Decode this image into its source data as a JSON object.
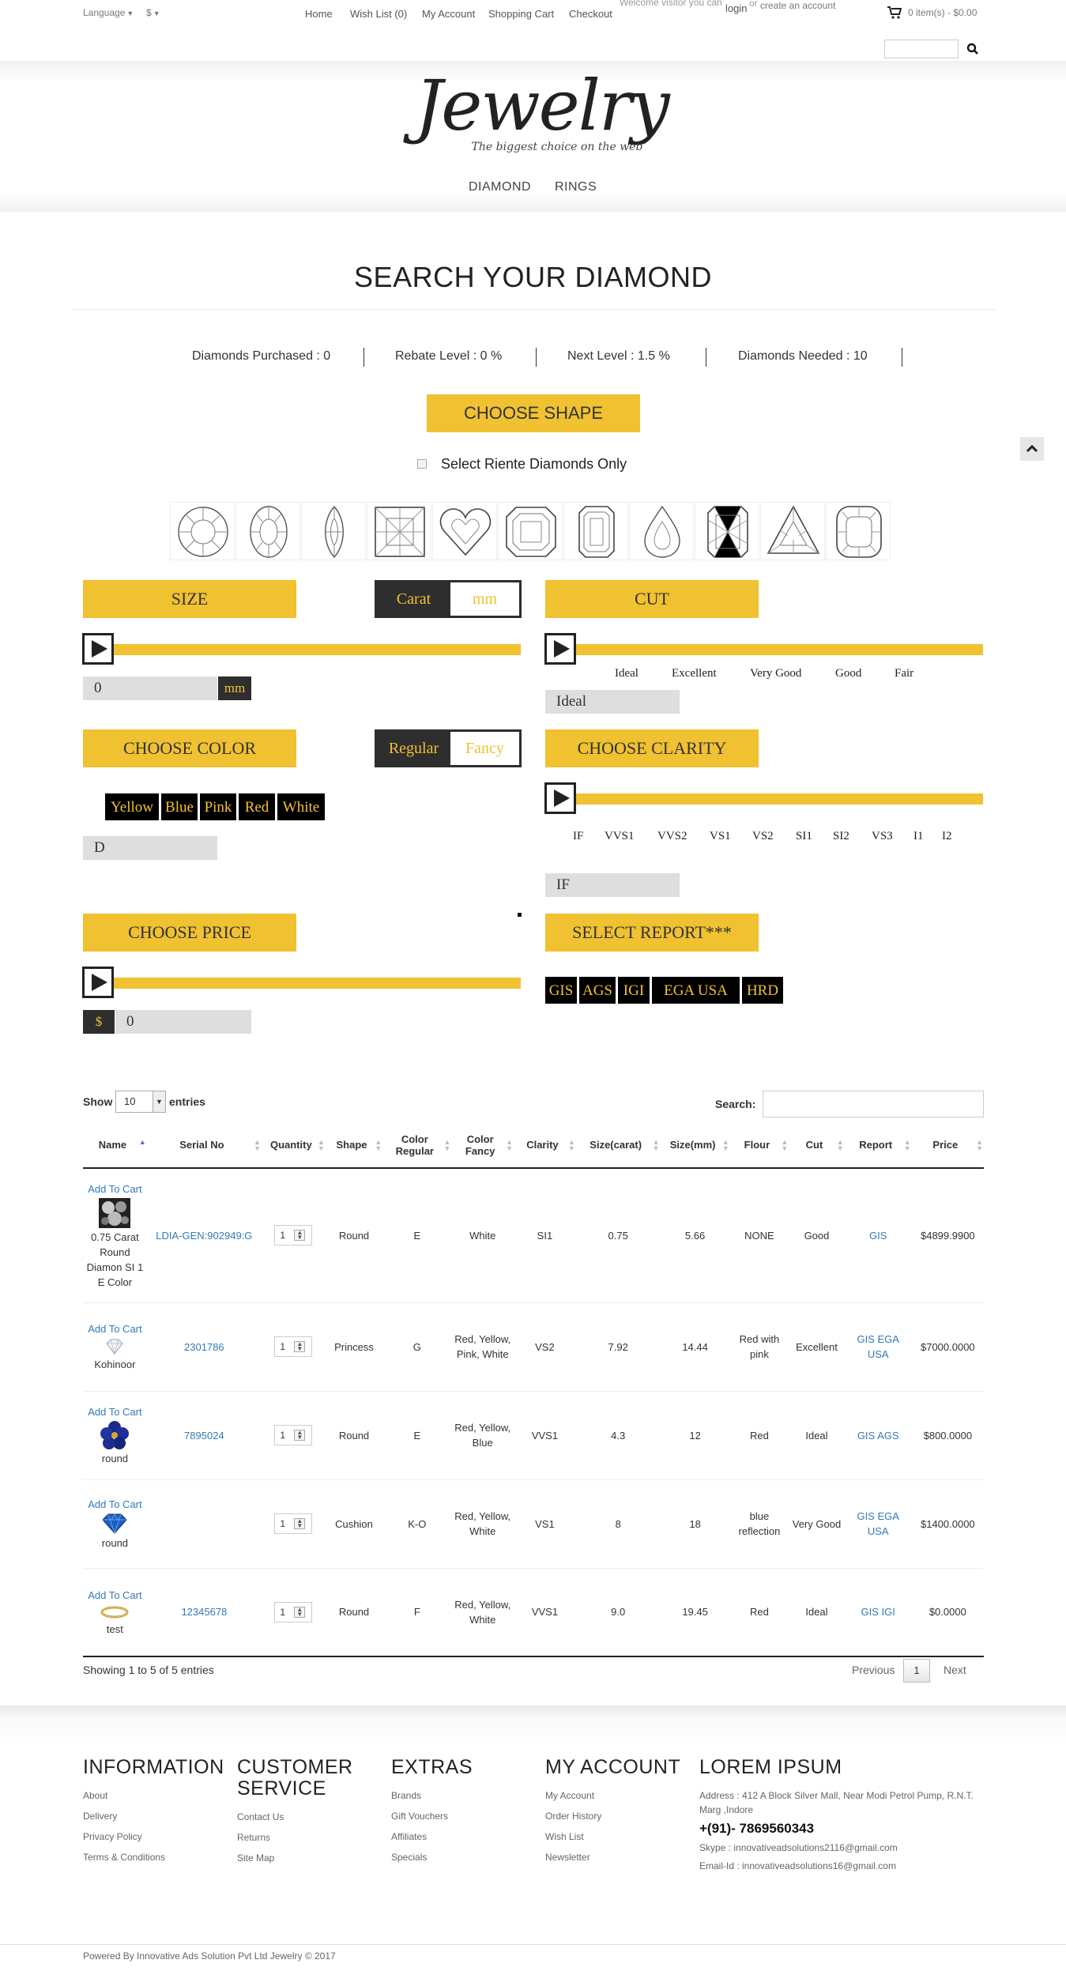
{
  "topbar": {
    "language": "Language",
    "currency": "$",
    "nav": [
      "Home",
      "Wish List (0)",
      "My Account",
      "Shopping Cart",
      "Checkout"
    ],
    "welcome_prefix": "Welcome visitor you can",
    "login": "login",
    "or": "or",
    "create_account": "create an account",
    "cart": "0 item(s) - $0.00"
  },
  "header": {
    "logo": "Jewelry",
    "tagline": "The biggest choice on the web",
    "nav": [
      "DIAMOND",
      "RINGS"
    ]
  },
  "page_title": "SEARCH YOUR DIAMOND",
  "stats": [
    "Diamonds Purchased : 0",
    "Rebate Level : 0 %",
    "Next Level : 1.5 %",
    "Diamonds Needed : 10"
  ],
  "choose_shape": "CHOOSE SHAPE",
  "riente_label": "Select Riente Diamonds Only",
  "shapes": [
    "round-shape-icon",
    "oval-shape-icon",
    "marquise-shape-icon",
    "princess-shape-icon",
    "heart-shape-icon",
    "asscher-shape-icon",
    "emerald-shape-icon",
    "pear-shape-icon",
    "radiant-shape-icon",
    "trillion-shape-icon",
    "cushion-shape-icon"
  ],
  "size": {
    "heading": "SIZE",
    "toggle": [
      "Carat",
      "mm"
    ],
    "value": "0",
    "unit": "mm"
  },
  "cut": {
    "heading": "CUT",
    "ticks": [
      "Ideal",
      "Excellent",
      "Very Good",
      "Good",
      "Fair"
    ],
    "value": "Ideal"
  },
  "color": {
    "heading": "CHOOSE COLOR",
    "toggle": [
      "Regular",
      "Fancy"
    ],
    "chips": [
      "Yellow",
      "Blue",
      "Pink",
      "Red",
      "White"
    ],
    "value": "D"
  },
  "clarity": {
    "heading": "CHOOSE CLARITY",
    "ticks": [
      "IF",
      "VVS1",
      "VVS2",
      "VS1",
      "VS2",
      "SI1",
      "SI2",
      "VS3",
      "I1",
      "I2"
    ],
    "value": "IF"
  },
  "price": {
    "heading": "CHOOSE PRICE",
    "currency": "$",
    "value": "0"
  },
  "report": {
    "heading": "SELECT REPORT***",
    "chips": [
      "GIS",
      "AGS",
      "IGI",
      "EGA USA",
      "HRD"
    ]
  },
  "table": {
    "show": "Show",
    "length": "10",
    "entries": "entries",
    "search_label": "Search:",
    "columns": [
      "Name",
      "Serial No",
      "Quantity",
      "Shape",
      "Color Regular",
      "Color Fancy",
      "Clarity",
      "Size(carat)",
      "Size(mm)",
      "Flour",
      "Cut",
      "Report",
      "Price"
    ],
    "add_to_cart": "Add To Cart",
    "rows": [
      {
        "name": "0.75 Carat Round Diamon SI 1 E Color",
        "thumb": "diamond-cluster",
        "serial": "LDIA-GEN:902949:G",
        "qty": "1",
        "shape": "Round",
        "color_regular": "E",
        "color_fancy": "White",
        "clarity": "SI1",
        "size_carat": "0.75",
        "size_mm": "5.66",
        "flour": "NONE",
        "cut": "Good",
        "report": "GIS",
        "price": "$4899.9900"
      },
      {
        "name": "Kohinoor",
        "thumb": "white-diamond",
        "serial": "2301786",
        "qty": "1",
        "shape": "Princess",
        "color_regular": "G",
        "color_fancy": "Red, Yellow, Pink, White",
        "clarity": "VS2",
        "size_carat": "7.92",
        "size_mm": "14.44",
        "flour": "Red with pink",
        "cut": "Excellent",
        "report": "GIS EGA USA",
        "price": "$7000.0000"
      },
      {
        "name": "round",
        "thumb": "blue-flower",
        "serial": "7895024",
        "qty": "1",
        "shape": "Round",
        "color_regular": "E",
        "color_fancy": "Red, Yellow, Blue",
        "clarity": "VVS1",
        "size_carat": "4.3",
        "size_mm": "12",
        "flour": "Red",
        "cut": "Ideal",
        "report": "GIS AGS",
        "price": "$800.0000"
      },
      {
        "name": "round",
        "thumb": "blue-diamond",
        "serial": "",
        "qty": "1",
        "shape": "Cushion",
        "color_regular": "K-O",
        "color_fancy": "Red, Yellow, White",
        "clarity": "VS1",
        "size_carat": "8",
        "size_mm": "18",
        "flour": "blue reflection",
        "cut": "Very Good",
        "report": "GIS EGA USA",
        "price": "$1400.0000"
      },
      {
        "name": "test",
        "thumb": "gold-ring",
        "serial": "12345678",
        "qty": "1",
        "shape": "Round",
        "color_regular": "F",
        "color_fancy": "Red, Yellow, White",
        "clarity": "VVS1",
        "size_carat": "9.0",
        "size_mm": "19.45",
        "flour": "Red",
        "cut": "Ideal",
        "report": "GIS IGI",
        "price": "$0.0000"
      }
    ],
    "info": "Showing 1 to 5 of 5 entries",
    "previous": "Previous",
    "page": "1",
    "next": "Next"
  },
  "footer": {
    "information": {
      "heading": "INFORMATION",
      "links": [
        "About",
        "Delivery",
        "Privacy Policy",
        "Terms & Conditions"
      ]
    },
    "customer_service": {
      "heading": "CUSTOMER SERVICE",
      "links": [
        "Contact Us",
        "Returns",
        "Site Map"
      ]
    },
    "extras": {
      "heading": "EXTRAS",
      "links": [
        "Brands",
        "Gift Vouchers",
        "Affiliates",
        "Specials"
      ]
    },
    "my_account": {
      "heading": "MY ACCOUNT",
      "links": [
        "My Account",
        "Order History",
        "Wish List",
        "Newsletter"
      ]
    },
    "contact": {
      "heading": "LOREM IPSUM",
      "address": "Address : 412 A Block Silver Mall, Near Modi Petrol Pump, R.N.T. Marg ,Indore",
      "phone": "+(91)- 7869560343",
      "skype": "Skype : innovativeadsolutions2116@gmail.com",
      "email": "Email-Id : innovativeadsolutions16@gmail.com"
    },
    "copyright": "Powered By Innovative Ads Solution Pvt Ltd Jewelry © 2017"
  },
  "colors": {
    "accent": "#f0c131",
    "dark": "#2e2e2e",
    "link": "#337ab7"
  }
}
